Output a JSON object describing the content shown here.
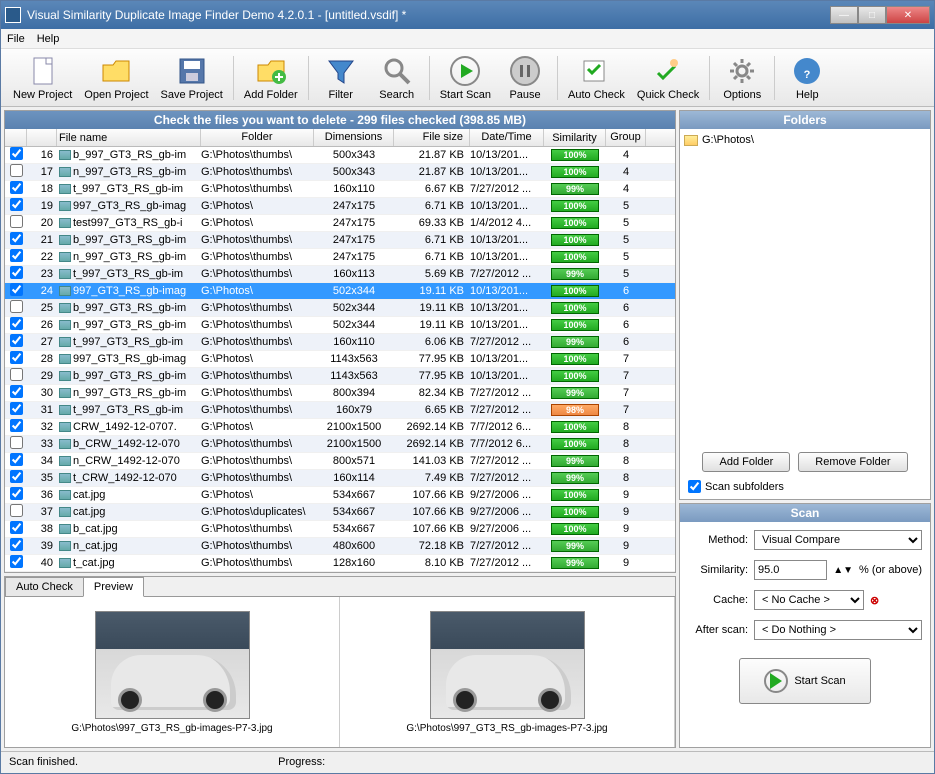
{
  "window": {
    "title": "Visual Similarity Duplicate Image Finder Demo 4.2.0.1 - [untitled.vsdif] *"
  },
  "menu": {
    "file": "File",
    "help": "Help"
  },
  "toolbar": {
    "new_project": "New Project",
    "open_project": "Open Project",
    "save_project": "Save Project",
    "add_folder": "Add Folder",
    "filter": "Filter",
    "search": "Search",
    "start_scan": "Start Scan",
    "pause": "Pause",
    "auto_check": "Auto Check",
    "quick_check": "Quick Check",
    "options": "Options",
    "help": "Help"
  },
  "list": {
    "header": "Check the files you want to delete - 299 files checked (398.85 MB)",
    "cols": {
      "filename": "File name",
      "folder": "Folder",
      "dimensions": "Dimensions",
      "filesize": "File size",
      "datetime": "Date/Time",
      "similarity": "Similarity",
      "group": "Group"
    },
    "rows": [
      {
        "chk": true,
        "n": 16,
        "name": "b_997_GT3_RS_gb-im",
        "fold": "G:\\Photos\\thumbs\\",
        "dim": "500x343",
        "size": "21.87 KB",
        "date": "10/13/201...",
        "sim": "100%",
        "simcls": "sim-100",
        "grp": 4,
        "alt": false
      },
      {
        "chk": false,
        "n": 17,
        "name": "n_997_GT3_RS_gb-im",
        "fold": "G:\\Photos\\thumbs\\",
        "dim": "500x343",
        "size": "21.87 KB",
        "date": "10/13/201...",
        "sim": "100%",
        "simcls": "sim-100",
        "grp": 4,
        "alt": true
      },
      {
        "chk": true,
        "n": 18,
        "name": "t_997_GT3_RS_gb-im",
        "fold": "G:\\Photos\\thumbs\\",
        "dim": "160x110",
        "size": "6.67 KB",
        "date": "7/27/2012 ...",
        "sim": "99%",
        "simcls": "sim-99",
        "grp": 4,
        "alt": false
      },
      {
        "chk": true,
        "n": 19,
        "name": "997_GT3_RS_gb-imag",
        "fold": "G:\\Photos\\",
        "dim": "247x175",
        "size": "6.71 KB",
        "date": "10/13/201...",
        "sim": "100%",
        "simcls": "sim-100",
        "grp": 5,
        "alt": true
      },
      {
        "chk": false,
        "n": 20,
        "name": "test997_GT3_RS_gb-i",
        "fold": "G:\\Photos\\",
        "dim": "247x175",
        "size": "69.33 KB",
        "date": "1/4/2012 4...",
        "sim": "100%",
        "simcls": "sim-100",
        "grp": 5,
        "alt": false
      },
      {
        "chk": true,
        "n": 21,
        "name": "b_997_GT3_RS_gb-im",
        "fold": "G:\\Photos\\thumbs\\",
        "dim": "247x175",
        "size": "6.71 KB",
        "date": "10/13/201...",
        "sim": "100%",
        "simcls": "sim-100",
        "grp": 5,
        "alt": true
      },
      {
        "chk": true,
        "n": 22,
        "name": "n_997_GT3_RS_gb-im",
        "fold": "G:\\Photos\\thumbs\\",
        "dim": "247x175",
        "size": "6.71 KB",
        "date": "10/13/201...",
        "sim": "100%",
        "simcls": "sim-100",
        "grp": 5,
        "alt": false
      },
      {
        "chk": true,
        "n": 23,
        "name": "t_997_GT3_RS_gb-im",
        "fold": "G:\\Photos\\thumbs\\",
        "dim": "160x113",
        "size": "5.69 KB",
        "date": "7/27/2012 ...",
        "sim": "99%",
        "simcls": "sim-99",
        "grp": 5,
        "alt": true
      },
      {
        "chk": true,
        "n": 24,
        "name": "997_GT3_RS_gb-imag",
        "fold": "G:\\Photos\\",
        "dim": "502x344",
        "size": "19.11 KB",
        "date": "10/13/201...",
        "sim": "100%",
        "simcls": "sim-100",
        "grp": 6,
        "sel": true
      },
      {
        "chk": false,
        "n": 25,
        "name": "b_997_GT3_RS_gb-im",
        "fold": "G:\\Photos\\thumbs\\",
        "dim": "502x344",
        "size": "19.11 KB",
        "date": "10/13/201...",
        "sim": "100%",
        "simcls": "sim-100",
        "grp": 6,
        "alt": true
      },
      {
        "chk": true,
        "n": 26,
        "name": "n_997_GT3_RS_gb-im",
        "fold": "G:\\Photos\\thumbs\\",
        "dim": "502x344",
        "size": "19.11 KB",
        "date": "10/13/201...",
        "sim": "100%",
        "simcls": "sim-100",
        "grp": 6,
        "alt": false
      },
      {
        "chk": true,
        "n": 27,
        "name": "t_997_GT3_RS_gb-im",
        "fold": "G:\\Photos\\thumbs\\",
        "dim": "160x110",
        "size": "6.06 KB",
        "date": "7/27/2012 ...",
        "sim": "99%",
        "simcls": "sim-99",
        "grp": 6,
        "alt": true
      },
      {
        "chk": true,
        "n": 28,
        "name": "997_GT3_RS_gb-imag",
        "fold": "G:\\Photos\\",
        "dim": "1143x563",
        "size": "77.95 KB",
        "date": "10/13/201...",
        "sim": "100%",
        "simcls": "sim-100",
        "grp": 7,
        "alt": false
      },
      {
        "chk": false,
        "n": 29,
        "name": "b_997_GT3_RS_gb-im",
        "fold": "G:\\Photos\\thumbs\\",
        "dim": "1143x563",
        "size": "77.95 KB",
        "date": "10/13/201...",
        "sim": "100%",
        "simcls": "sim-100",
        "grp": 7,
        "alt": true
      },
      {
        "chk": true,
        "n": 30,
        "name": "n_997_GT3_RS_gb-im",
        "fold": "G:\\Photos\\thumbs\\",
        "dim": "800x394",
        "size": "82.34 KB",
        "date": "7/27/2012 ...",
        "sim": "99%",
        "simcls": "sim-99",
        "grp": 7,
        "alt": false
      },
      {
        "chk": true,
        "n": 31,
        "name": "t_997_GT3_RS_gb-im",
        "fold": "G:\\Photos\\thumbs\\",
        "dim": "160x79",
        "size": "6.65 KB",
        "date": "7/27/2012 ...",
        "sim": "98%",
        "simcls": "sim-98",
        "grp": 7,
        "alt": true
      },
      {
        "chk": true,
        "n": 32,
        "name": "CRW_1492-12-0707.",
        "fold": "G:\\Photos\\",
        "dim": "2100x1500",
        "size": "2692.14 KB",
        "date": "7/7/2012 6...",
        "sim": "100%",
        "simcls": "sim-100",
        "grp": 8,
        "alt": false
      },
      {
        "chk": false,
        "n": 33,
        "name": "b_CRW_1492-12-070",
        "fold": "G:\\Photos\\thumbs\\",
        "dim": "2100x1500",
        "size": "2692.14 KB",
        "date": "7/7/2012 6...",
        "sim": "100%",
        "simcls": "sim-100",
        "grp": 8,
        "alt": true
      },
      {
        "chk": true,
        "n": 34,
        "name": "n_CRW_1492-12-070",
        "fold": "G:\\Photos\\thumbs\\",
        "dim": "800x571",
        "size": "141.03 KB",
        "date": "7/27/2012 ...",
        "sim": "99%",
        "simcls": "sim-99",
        "grp": 8,
        "alt": false
      },
      {
        "chk": true,
        "n": 35,
        "name": "t_CRW_1492-12-070",
        "fold": "G:\\Photos\\thumbs\\",
        "dim": "160x114",
        "size": "7.49 KB",
        "date": "7/27/2012 ...",
        "sim": "99%",
        "simcls": "sim-99",
        "grp": 8,
        "alt": true
      },
      {
        "chk": true,
        "n": 36,
        "name": "cat.jpg",
        "fold": "G:\\Photos\\",
        "dim": "534x667",
        "size": "107.66 KB",
        "date": "9/27/2006 ...",
        "sim": "100%",
        "simcls": "sim-100",
        "grp": 9,
        "alt": false
      },
      {
        "chk": false,
        "n": 37,
        "name": "cat.jpg",
        "fold": "G:\\Photos\\duplicates\\",
        "dim": "534x667",
        "size": "107.66 KB",
        "date": "9/27/2006 ...",
        "sim": "100%",
        "simcls": "sim-100",
        "grp": 9,
        "alt": true
      },
      {
        "chk": true,
        "n": 38,
        "name": "b_cat.jpg",
        "fold": "G:\\Photos\\thumbs\\",
        "dim": "534x667",
        "size": "107.66 KB",
        "date": "9/27/2006 ...",
        "sim": "100%",
        "simcls": "sim-100",
        "grp": 9,
        "alt": false
      },
      {
        "chk": true,
        "n": 39,
        "name": "n_cat.jpg",
        "fold": "G:\\Photos\\thumbs\\",
        "dim": "480x600",
        "size": "72.18 KB",
        "date": "7/27/2012 ...",
        "sim": "99%",
        "simcls": "sim-99",
        "grp": 9,
        "alt": true
      },
      {
        "chk": true,
        "n": 40,
        "name": "t_cat.jpg",
        "fold": "G:\\Photos\\thumbs\\",
        "dim": "128x160",
        "size": "8.10 KB",
        "date": "7/27/2012 ...",
        "sim": "99%",
        "simcls": "sim-99",
        "grp": 9,
        "alt": false
      }
    ]
  },
  "preview_tabs": {
    "auto_check": "Auto Check",
    "preview": "Preview"
  },
  "preview": {
    "left_cap": "G:\\Photos\\997_GT3_RS_gb-images-P7-3.jpg",
    "right_cap": "G:\\Photos\\997_GT3_RS_gb-images-P7-3.jpg"
  },
  "folders": {
    "header": "Folders",
    "items": [
      "G:\\Photos\\"
    ],
    "add": "Add Folder",
    "remove": "Remove Folder",
    "scan_sub": "Scan subfolders"
  },
  "scan": {
    "header": "Scan",
    "method_label": "Method:",
    "method_value": "Visual Compare",
    "sim_label": "Similarity:",
    "sim_value": "95.0",
    "sim_suffix": "% (or above)",
    "cache_label": "Cache:",
    "cache_value": "< No Cache >",
    "after_label": "After scan:",
    "after_value": "< Do Nothing >",
    "start": "Start Scan"
  },
  "status": {
    "left": "Scan finished.",
    "progress": "Progress:"
  }
}
